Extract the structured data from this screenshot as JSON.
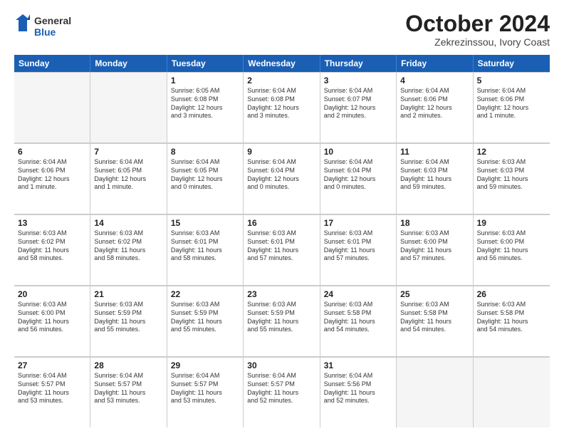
{
  "logo": {
    "line1": "General",
    "line2": "Blue"
  },
  "title": "October 2024",
  "location": "Zekrezinssou, Ivory Coast",
  "weekdays": [
    "Sunday",
    "Monday",
    "Tuesday",
    "Wednesday",
    "Thursday",
    "Friday",
    "Saturday"
  ],
  "weeks": [
    [
      {
        "day": "",
        "empty": true,
        "detail": ""
      },
      {
        "day": "",
        "empty": true,
        "detail": ""
      },
      {
        "day": "1",
        "detail": "Sunrise: 6:05 AM\nSunset: 6:08 PM\nDaylight: 12 hours\nand 3 minutes."
      },
      {
        "day": "2",
        "detail": "Sunrise: 6:04 AM\nSunset: 6:08 PM\nDaylight: 12 hours\nand 3 minutes."
      },
      {
        "day": "3",
        "detail": "Sunrise: 6:04 AM\nSunset: 6:07 PM\nDaylight: 12 hours\nand 2 minutes."
      },
      {
        "day": "4",
        "detail": "Sunrise: 6:04 AM\nSunset: 6:06 PM\nDaylight: 12 hours\nand 2 minutes."
      },
      {
        "day": "5",
        "detail": "Sunrise: 6:04 AM\nSunset: 6:06 PM\nDaylight: 12 hours\nand 1 minute."
      }
    ],
    [
      {
        "day": "6",
        "detail": "Sunrise: 6:04 AM\nSunset: 6:06 PM\nDaylight: 12 hours\nand 1 minute."
      },
      {
        "day": "7",
        "detail": "Sunrise: 6:04 AM\nSunset: 6:05 PM\nDaylight: 12 hours\nand 1 minute."
      },
      {
        "day": "8",
        "detail": "Sunrise: 6:04 AM\nSunset: 6:05 PM\nDaylight: 12 hours\nand 0 minutes."
      },
      {
        "day": "9",
        "detail": "Sunrise: 6:04 AM\nSunset: 6:04 PM\nDaylight: 12 hours\nand 0 minutes."
      },
      {
        "day": "10",
        "detail": "Sunrise: 6:04 AM\nSunset: 6:04 PM\nDaylight: 12 hours\nand 0 minutes."
      },
      {
        "day": "11",
        "detail": "Sunrise: 6:04 AM\nSunset: 6:03 PM\nDaylight: 11 hours\nand 59 minutes."
      },
      {
        "day": "12",
        "detail": "Sunrise: 6:03 AM\nSunset: 6:03 PM\nDaylight: 11 hours\nand 59 minutes."
      }
    ],
    [
      {
        "day": "13",
        "detail": "Sunrise: 6:03 AM\nSunset: 6:02 PM\nDaylight: 11 hours\nand 58 minutes."
      },
      {
        "day": "14",
        "detail": "Sunrise: 6:03 AM\nSunset: 6:02 PM\nDaylight: 11 hours\nand 58 minutes."
      },
      {
        "day": "15",
        "detail": "Sunrise: 6:03 AM\nSunset: 6:01 PM\nDaylight: 11 hours\nand 58 minutes."
      },
      {
        "day": "16",
        "detail": "Sunrise: 6:03 AM\nSunset: 6:01 PM\nDaylight: 11 hours\nand 57 minutes."
      },
      {
        "day": "17",
        "detail": "Sunrise: 6:03 AM\nSunset: 6:01 PM\nDaylight: 11 hours\nand 57 minutes."
      },
      {
        "day": "18",
        "detail": "Sunrise: 6:03 AM\nSunset: 6:00 PM\nDaylight: 11 hours\nand 57 minutes."
      },
      {
        "day": "19",
        "detail": "Sunrise: 6:03 AM\nSunset: 6:00 PM\nDaylight: 11 hours\nand 56 minutes."
      }
    ],
    [
      {
        "day": "20",
        "detail": "Sunrise: 6:03 AM\nSunset: 6:00 PM\nDaylight: 11 hours\nand 56 minutes."
      },
      {
        "day": "21",
        "detail": "Sunrise: 6:03 AM\nSunset: 5:59 PM\nDaylight: 11 hours\nand 55 minutes."
      },
      {
        "day": "22",
        "detail": "Sunrise: 6:03 AM\nSunset: 5:59 PM\nDaylight: 11 hours\nand 55 minutes."
      },
      {
        "day": "23",
        "detail": "Sunrise: 6:03 AM\nSunset: 5:59 PM\nDaylight: 11 hours\nand 55 minutes."
      },
      {
        "day": "24",
        "detail": "Sunrise: 6:03 AM\nSunset: 5:58 PM\nDaylight: 11 hours\nand 54 minutes."
      },
      {
        "day": "25",
        "detail": "Sunrise: 6:03 AM\nSunset: 5:58 PM\nDaylight: 11 hours\nand 54 minutes."
      },
      {
        "day": "26",
        "detail": "Sunrise: 6:03 AM\nSunset: 5:58 PM\nDaylight: 11 hours\nand 54 minutes."
      }
    ],
    [
      {
        "day": "27",
        "detail": "Sunrise: 6:04 AM\nSunset: 5:57 PM\nDaylight: 11 hours\nand 53 minutes."
      },
      {
        "day": "28",
        "detail": "Sunrise: 6:04 AM\nSunset: 5:57 PM\nDaylight: 11 hours\nand 53 minutes."
      },
      {
        "day": "29",
        "detail": "Sunrise: 6:04 AM\nSunset: 5:57 PM\nDaylight: 11 hours\nand 53 minutes."
      },
      {
        "day": "30",
        "detail": "Sunrise: 6:04 AM\nSunset: 5:57 PM\nDaylight: 11 hours\nand 52 minutes."
      },
      {
        "day": "31",
        "detail": "Sunrise: 6:04 AM\nSunset: 5:56 PM\nDaylight: 11 hours\nand 52 minutes."
      },
      {
        "day": "",
        "empty": true,
        "detail": ""
      },
      {
        "day": "",
        "empty": true,
        "detail": ""
      }
    ]
  ]
}
